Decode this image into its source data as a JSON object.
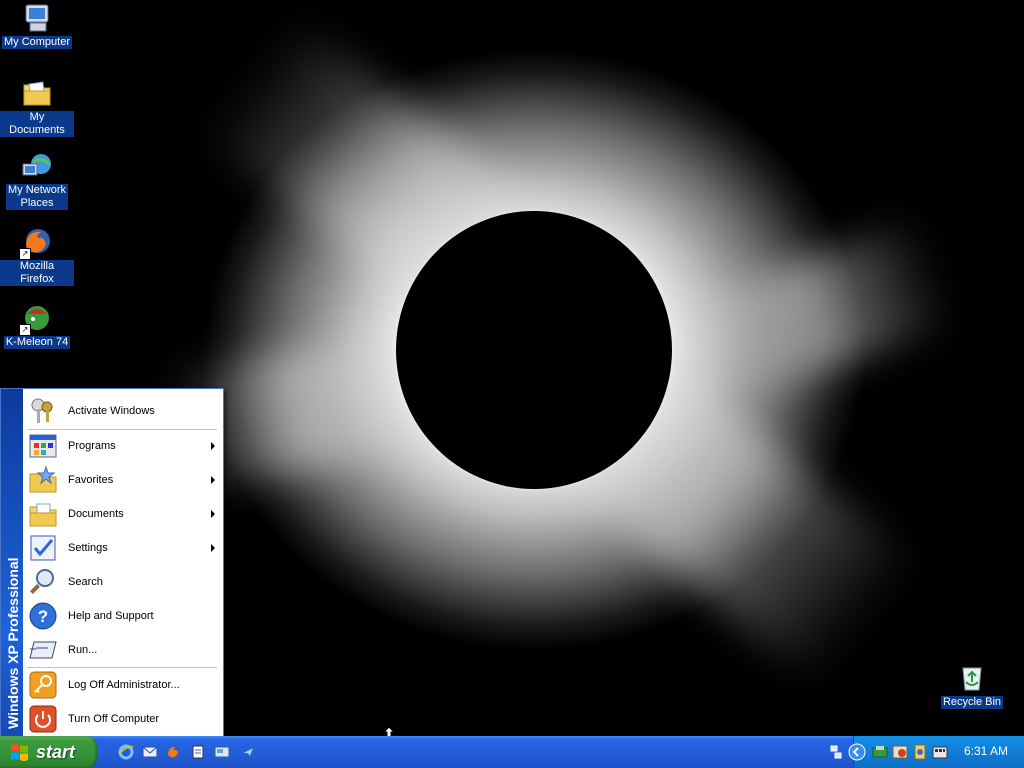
{
  "desktop": {
    "icons": [
      {
        "label": "My Computer"
      },
      {
        "label": "My Documents"
      },
      {
        "label_line1": "My Network",
        "label_line2": "Places"
      },
      {
        "label": "Mozilla Firefox"
      },
      {
        "label": "K-Meleon 74"
      },
      {
        "label": "Recycle Bin"
      }
    ]
  },
  "start_menu": {
    "side_band": "Windows XP Professional",
    "items": [
      {
        "label": "Activate Windows",
        "icon": "keys-icon"
      },
      {
        "label": "Programs",
        "icon": "programs-icon",
        "submenu": true
      },
      {
        "label": "Favorites",
        "icon": "favorites-folder-icon",
        "submenu": true
      },
      {
        "label": "Documents",
        "icon": "documents-folder-icon",
        "submenu": true
      },
      {
        "label": "Settings",
        "icon": "settings-icon",
        "submenu": true
      },
      {
        "label": "Search",
        "icon": "search-icon"
      },
      {
        "label": "Help and Support",
        "icon": "help-icon"
      },
      {
        "label": "Run...",
        "icon": "run-icon"
      },
      {
        "label": "Log Off Administrator...",
        "icon": "log-off-icon"
      },
      {
        "label": "Turn Off Computer",
        "icon": "power-icon"
      }
    ]
  },
  "taskbar": {
    "start_label": "start",
    "clock": "6:31 AM",
    "colors": {
      "taskbar": "#245edb",
      "start": "#35923a",
      "tray": "#0f7ed8"
    }
  }
}
